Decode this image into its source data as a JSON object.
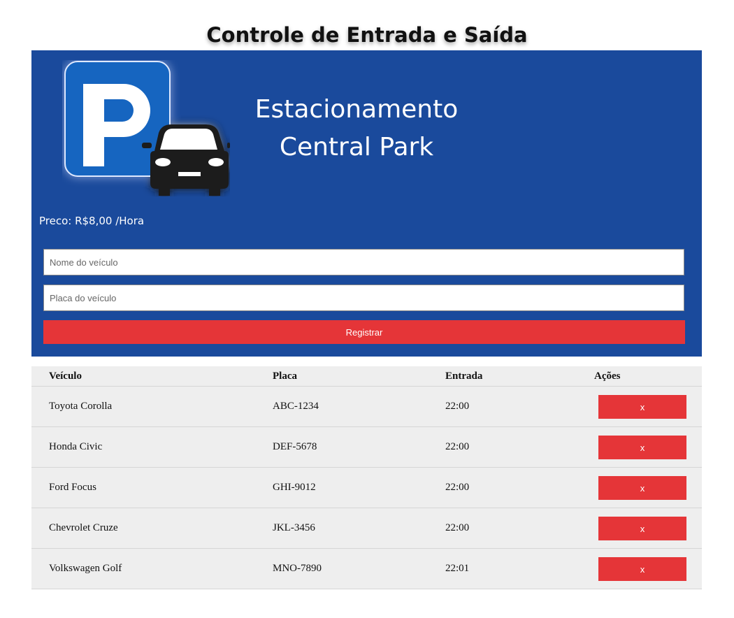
{
  "page": {
    "title": "Controle de Entrada e Saída"
  },
  "hero": {
    "brand_line1": "Estacionamento",
    "brand_line2": "Central Park",
    "price": "Preco: R$8,00 /Hora",
    "logo_icon": "parking-car-logo"
  },
  "form": {
    "name_placeholder": "Nome do veículo",
    "name_value": "",
    "plate_placeholder": "Placa do veículo",
    "plate_value": "",
    "submit_label": "Registrar"
  },
  "table": {
    "headers": {
      "vehicle": "Veículo",
      "plate": "Placa",
      "entry": "Entrada",
      "actions": "Ações"
    },
    "rows": [
      {
        "vehicle": "Toyota Corolla",
        "plate": "ABC-1234",
        "entry": "22:00",
        "action": "x"
      },
      {
        "vehicle": "Honda Civic",
        "plate": "DEF-5678",
        "entry": "22:00",
        "action": "x"
      },
      {
        "vehicle": "Ford Focus",
        "plate": "GHI-9012",
        "entry": "22:00",
        "action": "x"
      },
      {
        "vehicle": "Chevrolet Cruze",
        "plate": "JKL-3456",
        "entry": "22:00",
        "action": "x"
      },
      {
        "vehicle": "Volkswagen Golf",
        "plate": "MNO-7890",
        "entry": "22:01",
        "action": "x"
      }
    ]
  },
  "colors": {
    "hero_bg": "#1a4a9c",
    "accent_red": "#e53538",
    "table_bg": "#eeeeee"
  }
}
